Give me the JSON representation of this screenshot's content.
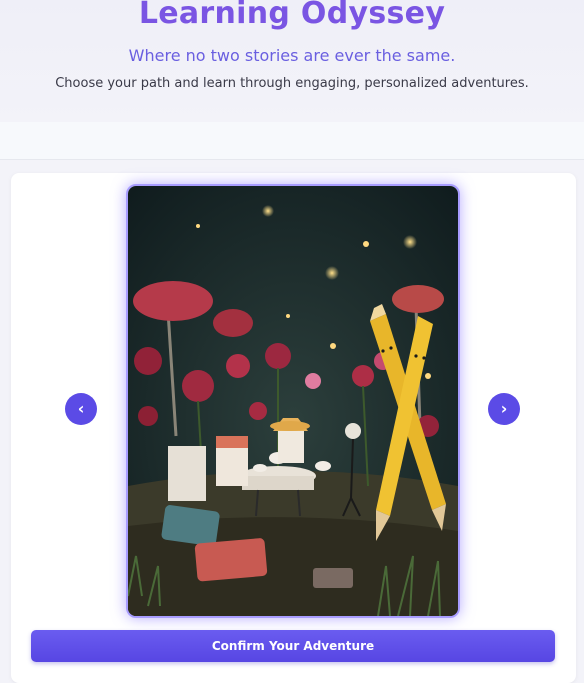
{
  "header": {
    "title": "Learning Odyssey",
    "tagline": "Where no two stories are ever the same.",
    "subtitle": "Choose your path and learn through engaging, personalized adventures."
  },
  "carousel": {
    "prev_label": "‹",
    "next_label": "›",
    "image_alt": "story-illustration"
  },
  "actions": {
    "confirm_label": "Confirm Your Adventure"
  },
  "colors": {
    "accent": "#5b4be6",
    "title": "#7a55e3",
    "tagline": "#6a5fe0"
  }
}
